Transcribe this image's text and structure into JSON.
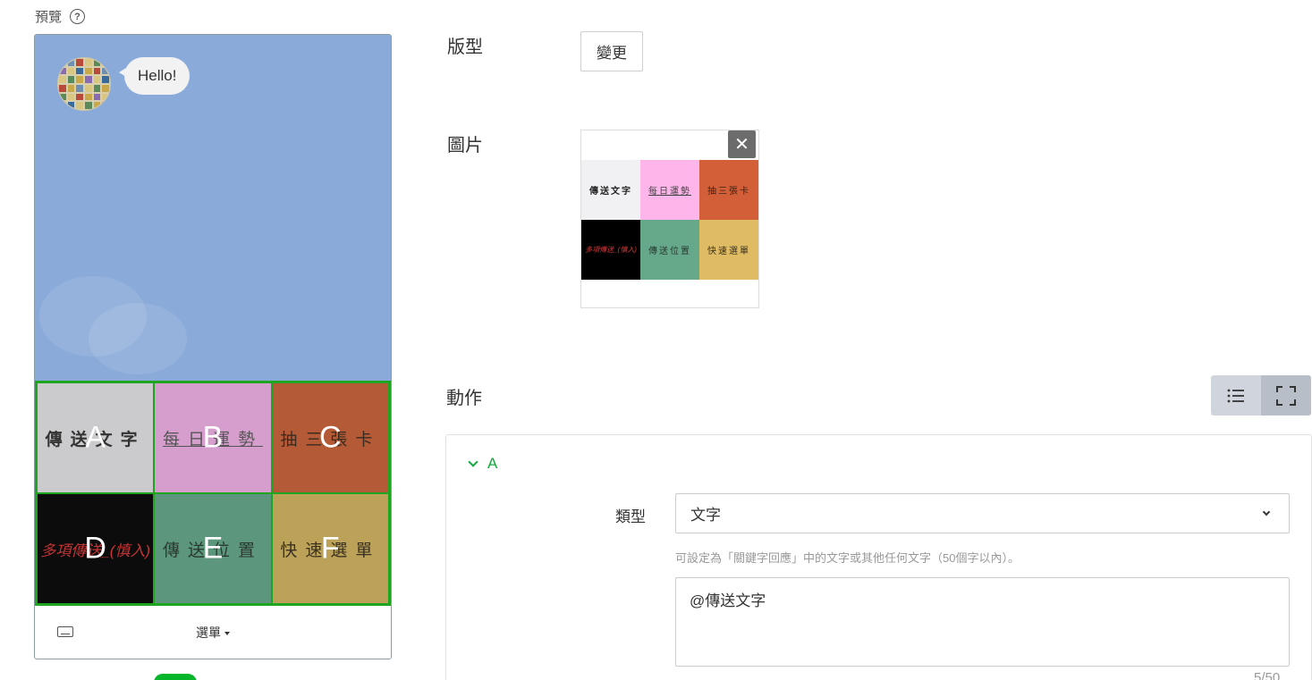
{
  "preview": {
    "label": "預覽",
    "help_icon": "?",
    "bubble_text": "Hello!",
    "rich_menu": [
      {
        "letter": "A",
        "text": "傳送文字",
        "bg": "#cbcbcd",
        "color": "#333333",
        "style": "bold"
      },
      {
        "letter": "B",
        "text": "每日運勢",
        "bg": "#d69ecd",
        "color": "#555555",
        "style": "underline"
      },
      {
        "letter": "C",
        "text": "抽三張卡",
        "bg": "#b55a36",
        "color": "#3a2a20",
        "style": "normal"
      },
      {
        "letter": "D",
        "text": "多項傳送_(慎入)",
        "bg": "#0c0c0d",
        "color": "#c73434",
        "style": "italic"
      },
      {
        "letter": "E",
        "text": "傳送位置",
        "bg": "#5c967c",
        "color": "#2a3a30",
        "style": "normal"
      },
      {
        "letter": "F",
        "text": "快速選單",
        "bg": "#bba258",
        "color": "#3a3020",
        "style": "normal"
      }
    ],
    "footer": {
      "keyboard_icon": "keyboard-icon",
      "menu_label": "選單"
    }
  },
  "layout_section": {
    "label": "版型",
    "change_button": "變更"
  },
  "image_section": {
    "label": "圖片",
    "close_icon": "✕",
    "thumb_cells": [
      {
        "text": "傳送文字",
        "bg": "#f1f1f3",
        "color": "#222222",
        "style": "bold"
      },
      {
        "text": "每日運勢",
        "bg": "#fdb5ea",
        "color": "#444444",
        "style": "underline"
      },
      {
        "text": "抽三張卡",
        "bg": "#d25f38",
        "color": "#3a2418",
        "style": "normal"
      },
      {
        "text": "多項傳送_(慎入)",
        "bg": "#000000",
        "color": "#d33a3a",
        "style": "italic"
      },
      {
        "text": "傳送位置",
        "bg": "#66a98a",
        "color": "#2a3a30",
        "style": "normal"
      },
      {
        "text": "快速選單",
        "bg": "#dfbc64",
        "color": "#3a3020",
        "style": "normal"
      }
    ]
  },
  "action_section": {
    "label": "動作",
    "view_toggle": {
      "list_icon": "list-icon",
      "expand_icon": "expand-icon",
      "active": "expand"
    },
    "accordion": {
      "title": "A",
      "type_label": "類型",
      "type_value": "文字",
      "hint": "可設定為「關鍵字回應」中的文字或其他任何文字（50個字以內）。",
      "text_value": "@傳送文字",
      "counter": "5/50"
    }
  },
  "colors": {
    "accent_green": "#12a83c",
    "toggle_green": "#06b52a",
    "chat_bg": "#8aaad9"
  }
}
